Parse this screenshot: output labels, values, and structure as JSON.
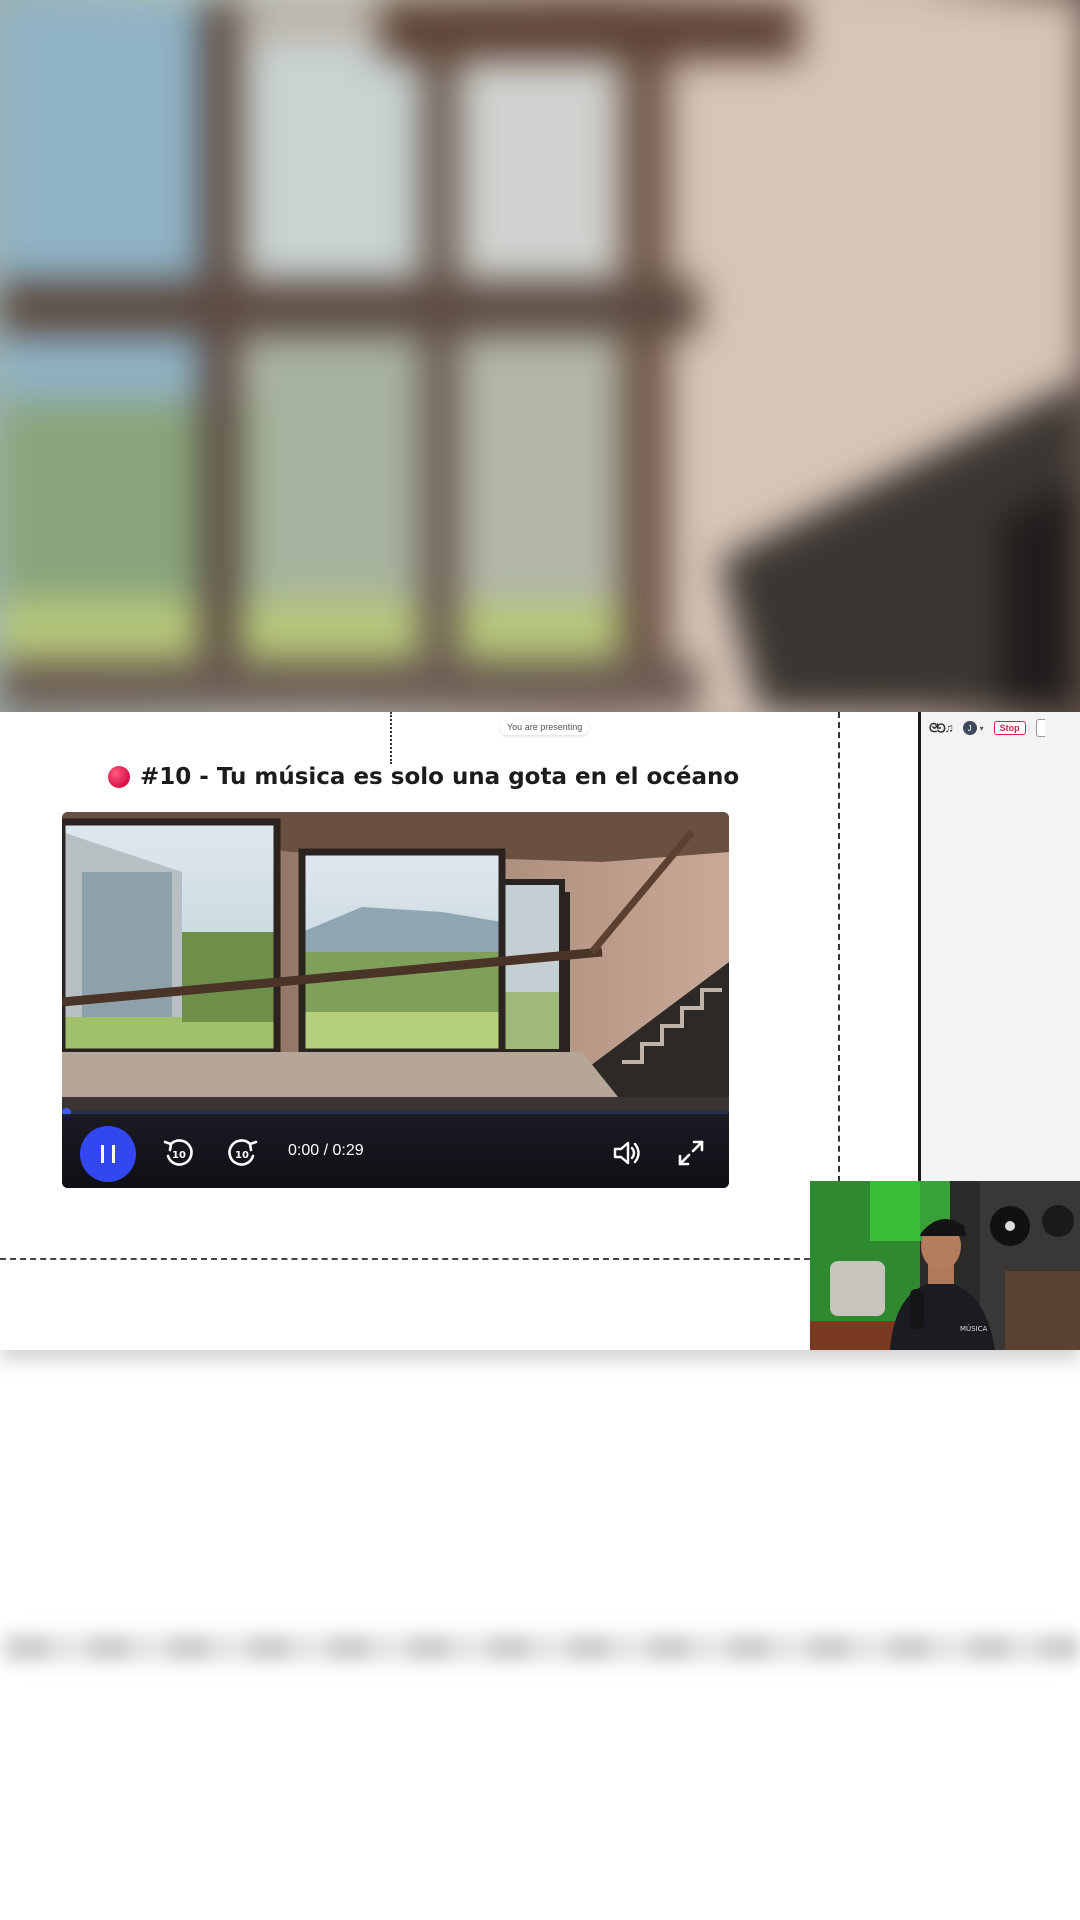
{
  "presentation": {
    "presenting_label": "You are presenting",
    "slide_title": "#10 - Tu música es solo una gota en el océano"
  },
  "toolbar": {
    "logo_text": "ᘓ⅁♫",
    "avatar_initial": "J",
    "stop_label": "Stop"
  },
  "video_player": {
    "time_display": "0:00 / 0:29",
    "progress": 0.0,
    "state": "playing",
    "colors": {
      "accent": "#3347f0",
      "control_bar": "#14161f"
    }
  },
  "icons": {
    "play_pause": "pause-icon",
    "rewind": "rewind-10-icon",
    "forward": "forward-10-icon",
    "volume": "volume-icon",
    "fullscreen": "fullscreen-icon",
    "title_marker": "red-dot-icon"
  }
}
